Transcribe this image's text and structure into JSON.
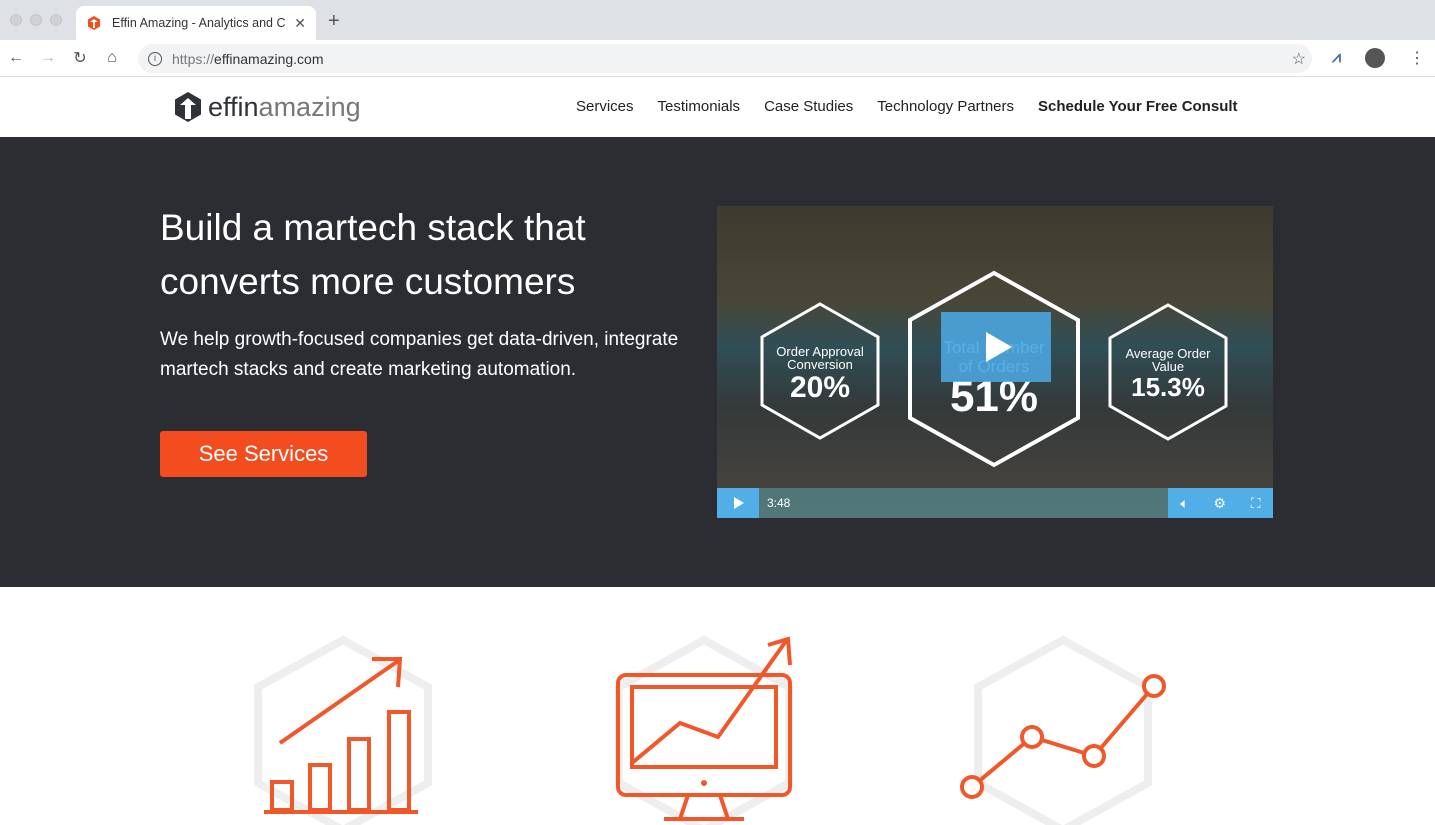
{
  "browser": {
    "tab_title": "Effin Amazing - Analytics and C",
    "url_scheme": "https://",
    "url_host": "effinamazing.com"
  },
  "site": {
    "logo_bold": "effin",
    "logo_light": "amazing",
    "nav": [
      {
        "label": "Services"
      },
      {
        "label": "Testimonials"
      },
      {
        "label": "Case Studies"
      },
      {
        "label": "Technology Partners"
      },
      {
        "label": "Schedule Your Free Consult"
      }
    ]
  },
  "hero": {
    "headline": "Build a martech stack that converts more customers",
    "subtext": "We help growth-focused companies get data-driven, integrate martech stacks and create marketing automation.",
    "cta": "See Services"
  },
  "video": {
    "stats": [
      {
        "label": "Order Approval Conversion",
        "value": "20%"
      },
      {
        "label": "Total Number of Orders",
        "value": "51%"
      },
      {
        "label": "Average Order Value",
        "value": "15.3%"
      }
    ],
    "duration": "3:48"
  },
  "colors": {
    "accent": "#f24c1f",
    "hero_bg": "#2b2d32",
    "video_control": "#51aee6"
  }
}
